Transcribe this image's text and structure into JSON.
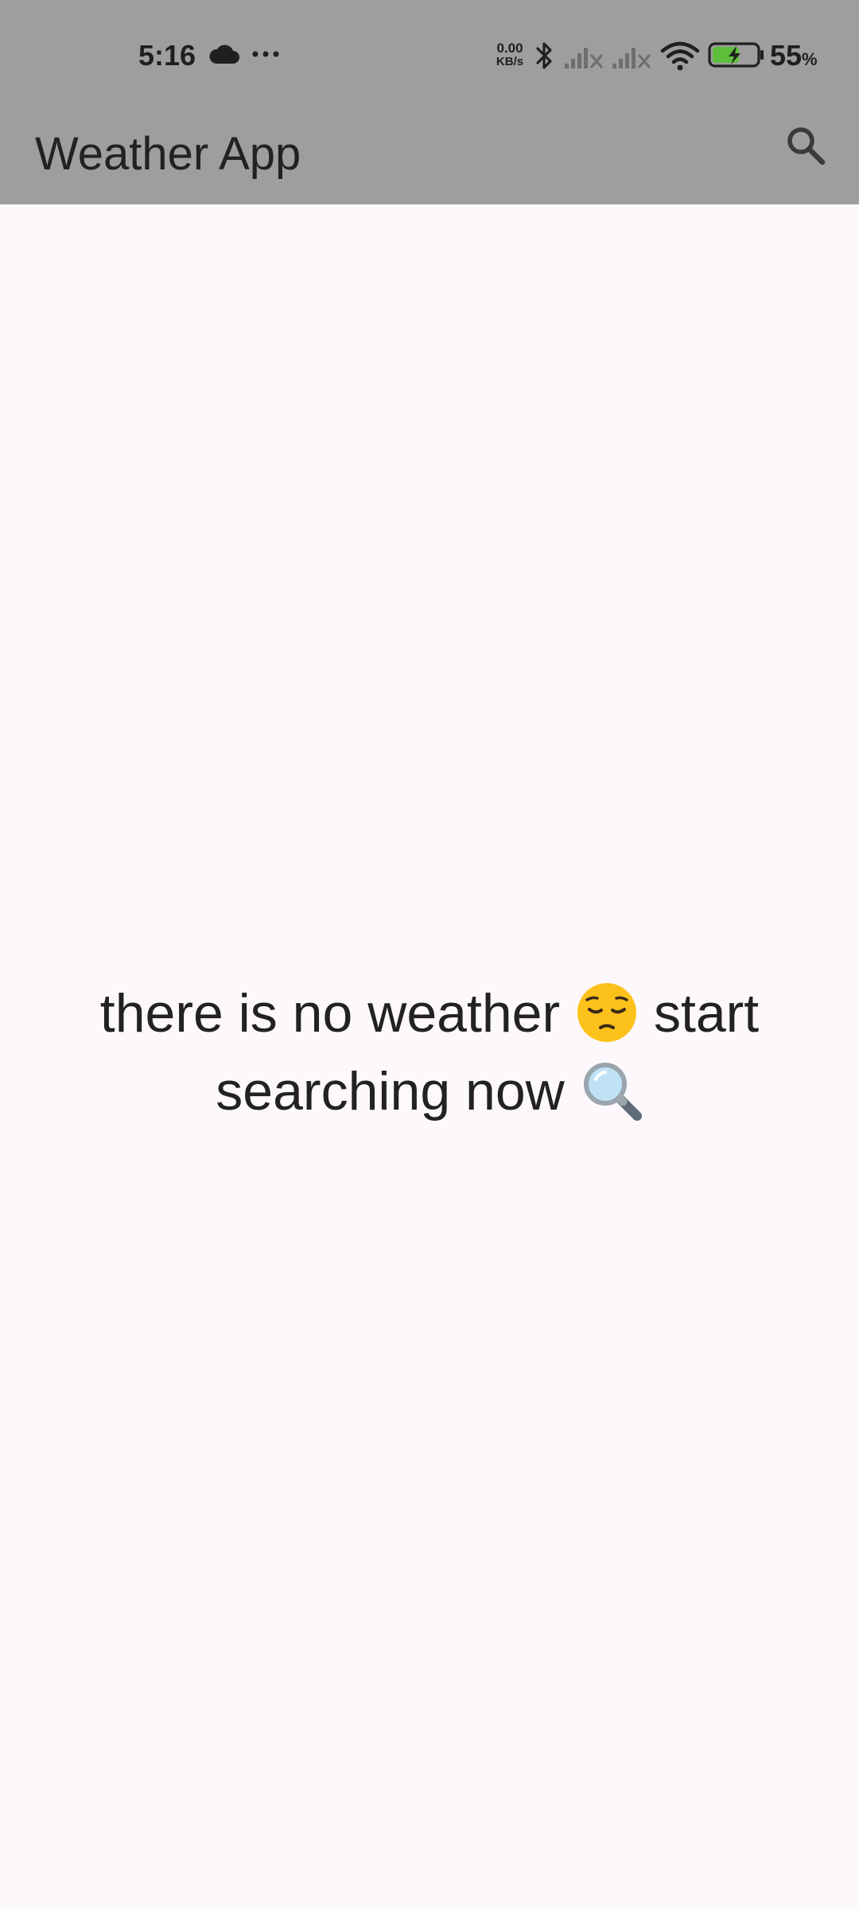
{
  "status_bar": {
    "time": "5:16",
    "net_speed_value": "0.00",
    "net_speed_unit": "KB/s",
    "battery_percent": "55",
    "battery_percent_sign": "%",
    "icons": [
      "cloud-icon",
      "more-icon",
      "bluetooth-icon",
      "signal-icon",
      "signal-icon",
      "wifi-icon",
      "battery-charging-icon"
    ]
  },
  "app_bar": {
    "title": "Weather App",
    "action_icon": "search-icon",
    "background_color": "#9e9e9e"
  },
  "main": {
    "message_part1": "there is no weather",
    "message_part2": "start searching now",
    "emoji_1": "pensive-face-emoji",
    "emoji_2": "magnifying-glass-emoji",
    "background_color": "#fdf8fc"
  }
}
